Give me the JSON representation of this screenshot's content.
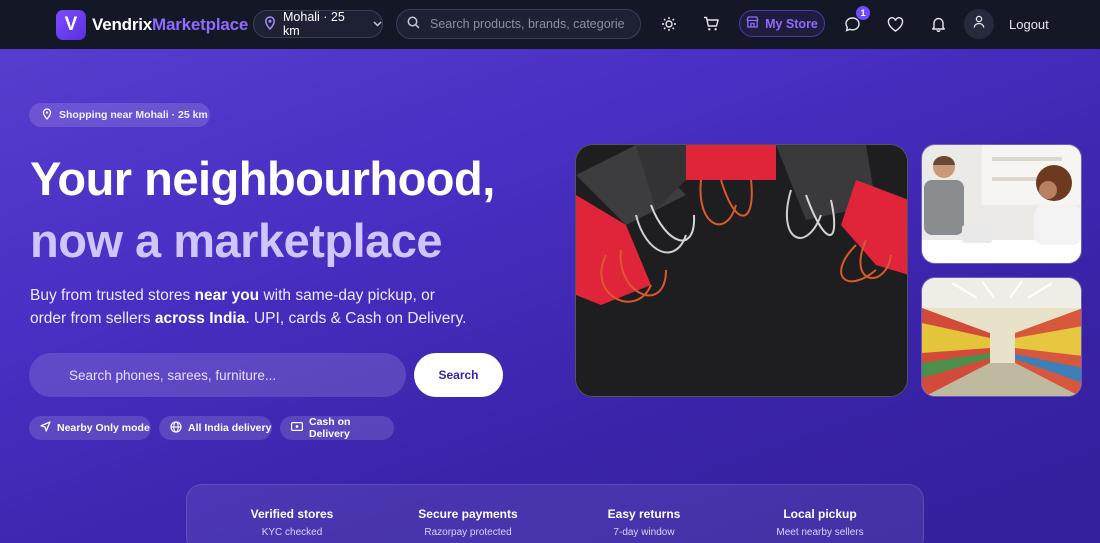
{
  "brand": {
    "name_part1": "Vendrix",
    "name_part2": "Marketplace",
    "logo_letter": "V"
  },
  "nav": {
    "location_label": "Mohali · 25 km",
    "search_placeholder": "Search products, brands, categories...",
    "my_store_label": "My Store",
    "messages_badge_count": "1",
    "logout_label": "Logout",
    "icons": [
      "theme-icon",
      "cart-icon",
      "store-icon",
      "chat-icon",
      "heart-icon",
      "bell-icon",
      "user-icon"
    ]
  },
  "hero": {
    "location_chip": "Shopping near Mohali · 25 km",
    "headline_line1": "Your neighbourhood,",
    "headline_line2": "now a marketplace",
    "subtitle_part1": "Buy from trusted stores ",
    "subtitle_bold1": "near you",
    "subtitle_part2": " with same-day pickup, or order from sellers ",
    "subtitle_bold2": "across India",
    "subtitle_part3": ". UPI, cards & Cash on Delivery.",
    "search_placeholder": "Search phones, sarees, furniture...",
    "search_button": "Search",
    "chips": [
      {
        "label": "Nearby Only mode",
        "icon": "navigation-icon"
      },
      {
        "label": "All India delivery",
        "icon": "globe-icon"
      },
      {
        "label": "Cash on Delivery",
        "icon": "cash-icon"
      }
    ]
  },
  "features": [
    {
      "title": "Verified stores",
      "subtitle": "KYC checked"
    },
    {
      "title": "Secure payments",
      "subtitle": "Razorpay protected"
    },
    {
      "title": "Easy returns",
      "subtitle": "7-day window"
    },
    {
      "title": "Local pickup",
      "subtitle": "Meet nearby sellers"
    }
  ],
  "colors": {
    "nav_bg": "#141726",
    "accent": "#8f6bff",
    "hero_bg_start": "#5b3fd0",
    "hero_bg_end": "#33209a",
    "headline_secondary": "#cfc6ff"
  }
}
